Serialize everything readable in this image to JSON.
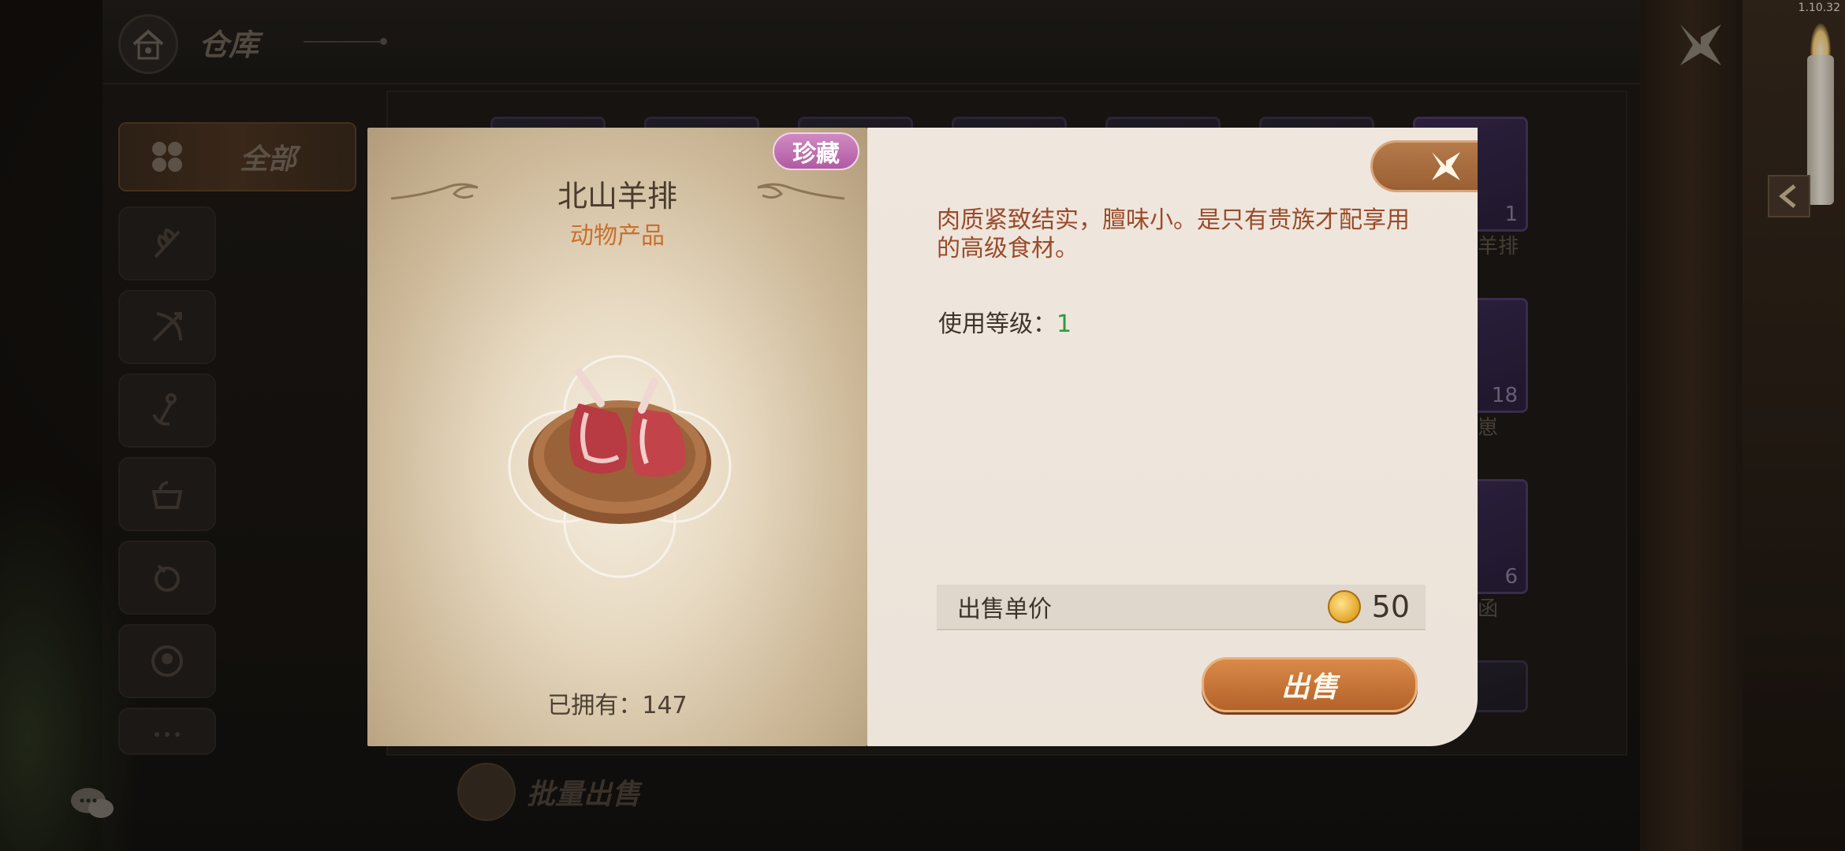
{
  "version": "1.10.32",
  "header": {
    "title": "仓库"
  },
  "sidebar": {
    "all_label": "全部"
  },
  "grid": {
    "visible_counts": [
      "1",
      "18",
      "6"
    ],
    "visible_names": [
      "戈羊排",
      "动崽",
      "公函"
    ]
  },
  "footer": {
    "bulk_sell_label": "批量出售"
  },
  "item": {
    "name": "北山羊排",
    "category": "动物产品",
    "rarity": "珍藏",
    "description": "肉质紧致结实，膻味小。是只有贵族才配享用的高级食材。",
    "use_level_label": "使用等级：",
    "use_level_value": "1",
    "owned_label": "已拥有：",
    "owned_value": "147",
    "price_label": "出售单价",
    "price_value": "50",
    "sell_label": "出售"
  },
  "colors": {
    "category": "#c8702e",
    "description": "#9a4b2a",
    "level_value": "#2f9a3a",
    "rarity_badge": "#b05aa2",
    "sell_button": "#b4622a"
  },
  "icons": [
    "home-icon",
    "close-x-icon",
    "all-categories-icon",
    "wheat-icon",
    "bow-icon",
    "anchor-icon",
    "pot-icon",
    "orb-icon",
    "portrait-icon",
    "more-icon",
    "chat-icon",
    "gold-coin-icon",
    "back-arrow-icon"
  ]
}
